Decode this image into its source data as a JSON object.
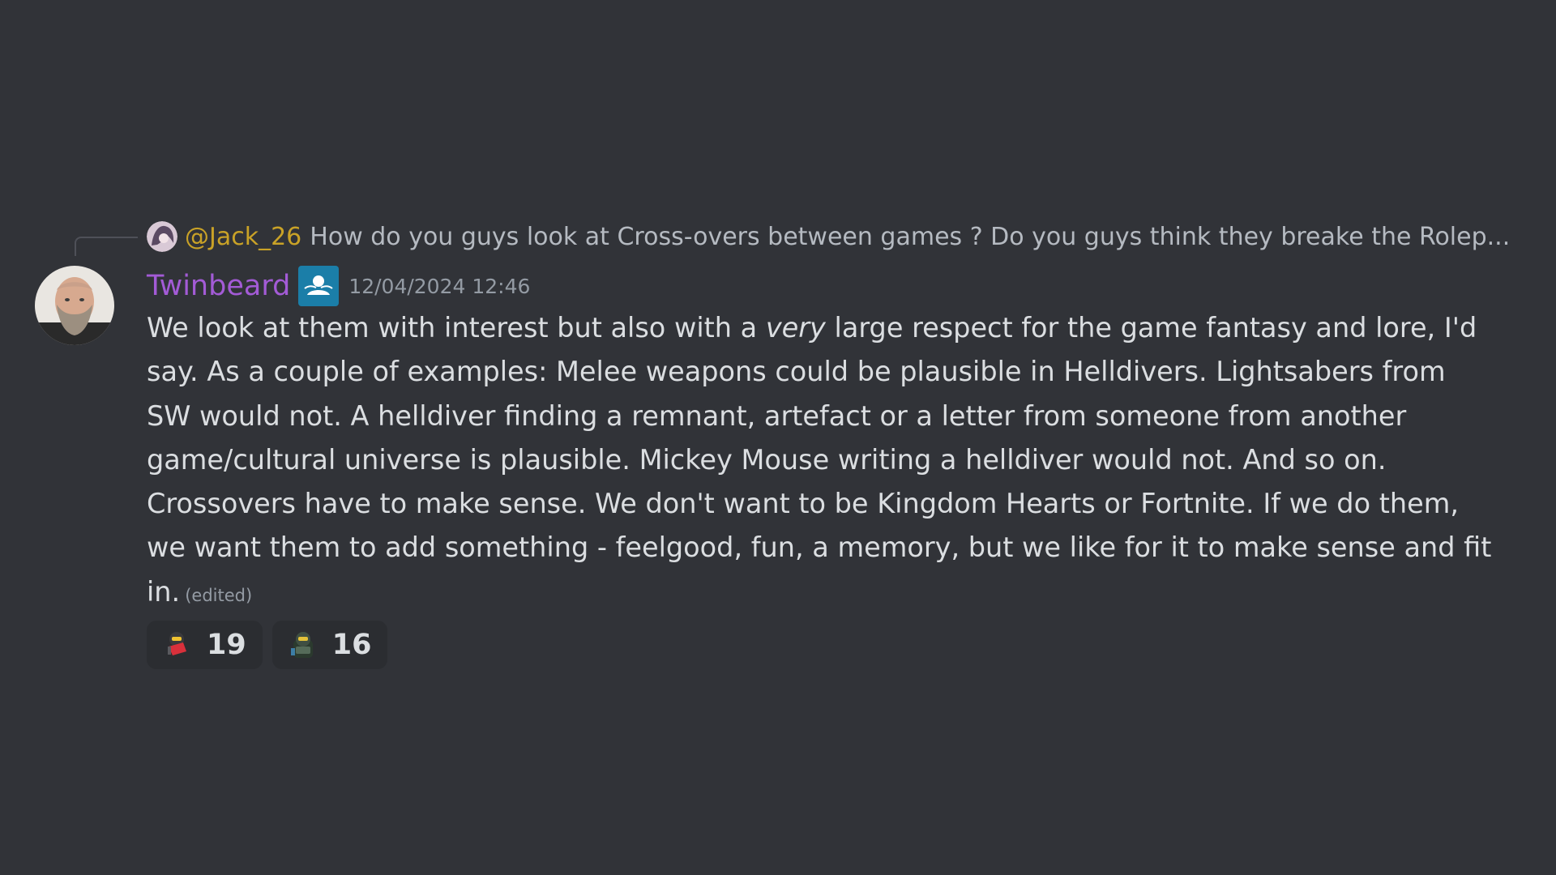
{
  "reply": {
    "mention": "@Jack_26",
    "preview": "How do you guys look at Cross-overs between games ? Do you guys think they breake the Rolep..."
  },
  "author": {
    "username": "Twinbeard",
    "timestamp": "12/04/2024 12:46",
    "name_color": "#a35bd6"
  },
  "message": {
    "line1_before": "We look at them with interest but also with a ",
    "line1_emphasis": "very",
    "line1_after": " large respect for the game fantasy and lore, I'd",
    "line2": "say. As a couple of examples: Melee weapons could be plausible in Helldivers. Lightsabers from",
    "line3": "SW would not. A helldiver finding a remnant, artefact or a letter from someone from another",
    "line4": "game/cultural universe is plausible. Mickey Mouse writing a helldiver would not. And so on.",
    "line5": "Crossovers have to make sense. We don't want to be Kingdom Hearts or Fortnite. If we do them,",
    "line6": "we want them to add something - feelgood, fun, a memory, but we like for it to make sense and fit",
    "line7": "in.",
    "edited_label": "(edited)"
  },
  "reactions": [
    {
      "icon": "helldiver-emoji-red",
      "count": "19"
    },
    {
      "icon": "helldiver-emoji-green",
      "count": "16"
    }
  ],
  "colors": {
    "background": "#313338",
    "mention": "#c9a227",
    "role_badge": "#1b7ea8"
  }
}
